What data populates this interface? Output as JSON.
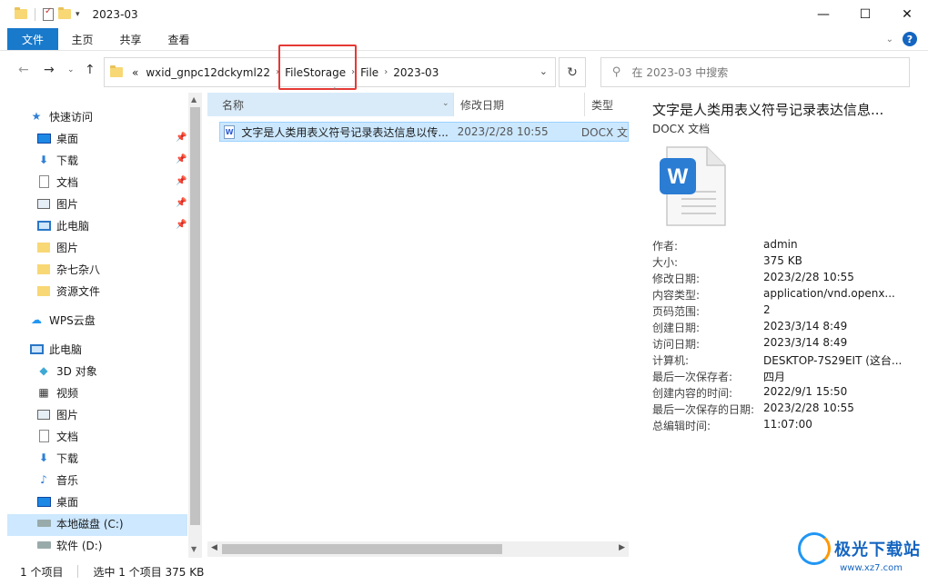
{
  "titlebar": {
    "title": "2023-03",
    "controls": [
      "—",
      "☐",
      "✕"
    ]
  },
  "ribbon": {
    "file_tab": "文件",
    "tabs": [
      "主页",
      "共享",
      "查看"
    ],
    "help": "?"
  },
  "address": {
    "overflow": "«",
    "crumbs": [
      "wxid_gnpc12dckyml22",
      "FileStorage",
      "File",
      "2023-03"
    ],
    "search_placeholder": "在 2023-03 中搜索"
  },
  "sidebar": {
    "quick_access": "快速访问",
    "quick_items": [
      {
        "label": "桌面",
        "icon": "desktop-icon",
        "pinned": true
      },
      {
        "label": "下载",
        "icon": "download-icon",
        "pinned": true
      },
      {
        "label": "文档",
        "icon": "document-icon",
        "pinned": true
      },
      {
        "label": "图片",
        "icon": "picture-icon",
        "pinned": true
      },
      {
        "label": "此电脑",
        "icon": "computer-icon",
        "pinned": true
      },
      {
        "label": "图片",
        "icon": "folder-icon",
        "pinned": false
      },
      {
        "label": "杂七杂八",
        "icon": "folder-icon",
        "pinned": false
      },
      {
        "label": "资源文件",
        "icon": "folder-icon",
        "pinned": false
      }
    ],
    "wps": "WPS云盘",
    "this_pc": "此电脑",
    "pc_items": [
      {
        "label": "3D 对象",
        "icon": "cube-icon"
      },
      {
        "label": "视频",
        "icon": "video-icon"
      },
      {
        "label": "图片",
        "icon": "picture-icon"
      },
      {
        "label": "文档",
        "icon": "document-icon"
      },
      {
        "label": "下载",
        "icon": "download-icon"
      },
      {
        "label": "音乐",
        "icon": "music-icon"
      },
      {
        "label": "桌面",
        "icon": "desktop-icon"
      },
      {
        "label": "本地磁盘 (C:)",
        "icon": "drive-icon"
      },
      {
        "label": "软件 (D:)",
        "icon": "drive-icon"
      }
    ]
  },
  "filelist": {
    "columns": {
      "name": "名称",
      "date": "修改日期",
      "type": "类型"
    },
    "rows": [
      {
        "name": "文字是人类用表义符号记录表达信息以传...",
        "date": "2023/2/28 10:55",
        "type": "DOCX 文"
      }
    ]
  },
  "preview": {
    "title": "文字是人类用表义符号记录表达信息...",
    "subtitle": "DOCX 文档",
    "doc_badge": "W",
    "properties": [
      {
        "k": "作者:",
        "v": "admin"
      },
      {
        "k": "大小:",
        "v": "375 KB"
      },
      {
        "k": "修改日期:",
        "v": "2023/2/28 10:55"
      },
      {
        "k": "内容类型:",
        "v": "application/vnd.openx..."
      },
      {
        "k": "页码范围:",
        "v": "2"
      },
      {
        "k": "创建日期:",
        "v": "2023/3/14 8:49"
      },
      {
        "k": "访问日期:",
        "v": "2023/3/14 8:49"
      },
      {
        "k": "计算机:",
        "v": "DESKTOP-7S29EIT (这台..."
      },
      {
        "k": "最后一次保存者:",
        "v": "四月"
      },
      {
        "k": "创建内容的时间:",
        "v": "2022/9/1 15:50"
      },
      {
        "k": "最后一次保存的日期:",
        "v": "2023/2/28 10:55"
      },
      {
        "k": "总编辑时间:",
        "v": "11:07:00"
      }
    ]
  },
  "status": {
    "count": "1 个项目",
    "selected": "选中 1 个项目  375 KB"
  },
  "watermark": {
    "text": "极光下载站",
    "url": "www.xz7.com"
  },
  "colors": {
    "accent": "#1979ca",
    "selection": "#cce8ff",
    "highlight_box": "#e53935"
  }
}
